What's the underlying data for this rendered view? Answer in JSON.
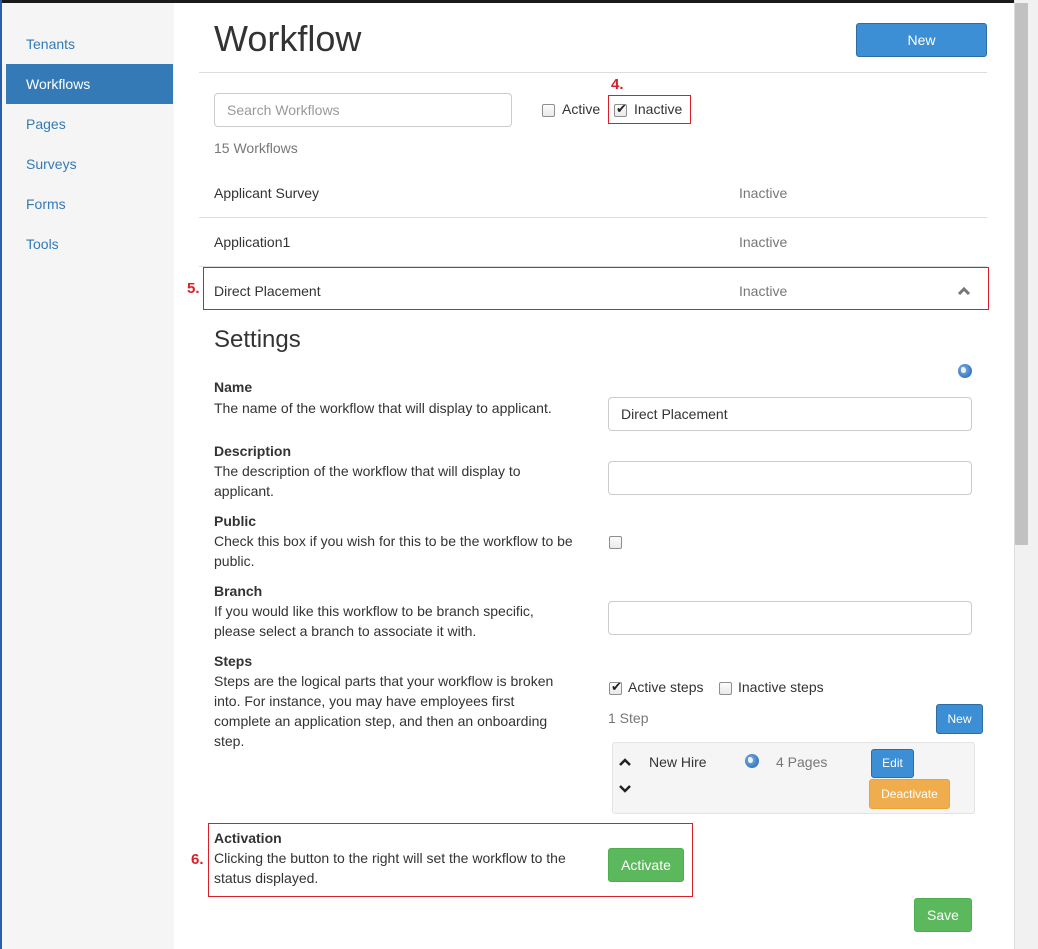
{
  "sidebar": {
    "items": [
      {
        "label": "Tenants",
        "active": false
      },
      {
        "label": "Workflows",
        "active": true
      },
      {
        "label": "Pages",
        "active": false
      },
      {
        "label": "Surveys",
        "active": false
      },
      {
        "label": "Forms",
        "active": false
      },
      {
        "label": "Tools",
        "active": false
      }
    ]
  },
  "header": {
    "title": "Workflow",
    "new_button": "New"
  },
  "filters": {
    "search_placeholder": "Search Workflows",
    "active_label": "Active",
    "active_checked": false,
    "inactive_label": "Inactive",
    "inactive_checked": true,
    "count_text": "15 Workflows"
  },
  "workflows": [
    {
      "name": "Applicant Survey",
      "status": "Inactive"
    },
    {
      "name": "Application1",
      "status": "Inactive"
    },
    {
      "name": "Direct Placement",
      "status": "Inactive",
      "expanded": true
    }
  ],
  "annotations": {
    "a4": "4.",
    "a5": "5.",
    "a6": "6."
  },
  "settings": {
    "heading": "Settings",
    "name": {
      "label": "Name",
      "description": "The name of the workflow that will display to applicant.",
      "value": "Direct Placement"
    },
    "description": {
      "label": "Description",
      "description": "The description of the workflow that will display to applicant.",
      "value": ""
    },
    "public": {
      "label": "Public",
      "description": "Check this box if you wish for this to be the workflow to be public.",
      "checked": false
    },
    "branch": {
      "label": "Branch",
      "description": "If you would like this workflow to be branch specific, please select a branch to associate it with.",
      "value": ""
    },
    "steps": {
      "label": "Steps",
      "description": "Steps are the logical parts that your workflow is broken into. For instance, you may have employees first complete an application step, and then an onboarding step.",
      "active_steps_label": "Active steps",
      "active_steps_checked": true,
      "inactive_steps_label": "Inactive steps",
      "inactive_steps_checked": false,
      "count_text": "1 Step",
      "new_button": "New",
      "items": [
        {
          "name": "New Hire",
          "pages": "4 Pages",
          "edit_label": "Edit",
          "deactivate_label": "Deactivate"
        }
      ]
    },
    "activation": {
      "label": "Activation",
      "description": "Clicking the button to the right will set the workflow to the status displayed.",
      "button": "Activate"
    },
    "save_button": "Save"
  },
  "colors": {
    "primary": "#3c8ed5",
    "success": "#5cb85c",
    "warning": "#f0ad4e",
    "annotation": "#d9202a",
    "link": "#337ab7"
  }
}
